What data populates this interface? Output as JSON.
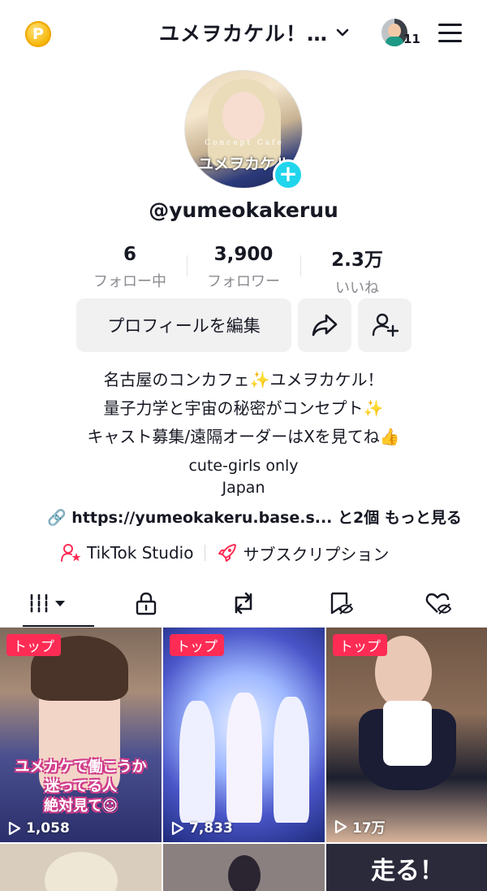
{
  "header": {
    "coin_icon": "coin-icon",
    "title": "ユメヲカケル！…",
    "notification_count": "11"
  },
  "profile": {
    "avatar_caption": "Concept Cafe",
    "avatar_name": "ユメヲカケル",
    "username": "@yumeokakeruu"
  },
  "stats": [
    {
      "value": "6",
      "label": "フォロー中"
    },
    {
      "value": "3,900",
      "label": "フォロワー"
    },
    {
      "value": "2.3万",
      "label": "いいね"
    }
  ],
  "actions": {
    "edit_profile": "プロフィールを編集"
  },
  "bio": {
    "line1": "名古屋のコンカフェ✨ユメヲカケル！",
    "line2": "量子力学と宇宙の秘密がコンセプト✨",
    "line3": "キャスト募集/遠隔オーダーはXを見てね👍",
    "line4": "cute-girls only",
    "line5": "Japan"
  },
  "link": {
    "url": "https://yumeokakeru.base.s...",
    "more_count": "と2個",
    "more_label": "もっと見る"
  },
  "extras": {
    "studio": "TikTok Studio",
    "subscription": "サブスクリプション"
  },
  "videos": [
    {
      "tag": "トップ",
      "views": "1,058",
      "caption_l1": "ユメカケで働こうか",
      "caption_l2": "迷ってる人",
      "caption_l3": "絶対見て☺"
    },
    {
      "tag": "トップ",
      "views": "7,833"
    },
    {
      "tag": "トップ",
      "views": "17万"
    },
    {
      "caption": "走る！"
    }
  ],
  "colors": {
    "accent_pink": "#fe2c55",
    "accent_cyan": "#20d5ec",
    "text": "#161823",
    "muted": "#8a8b91"
  }
}
